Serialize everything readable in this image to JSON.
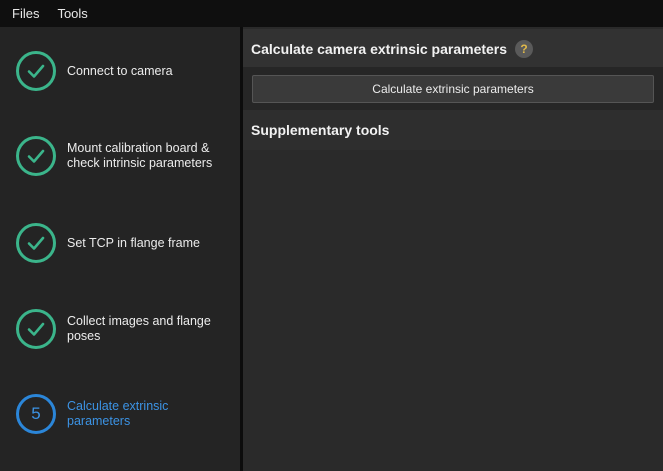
{
  "menubar": {
    "items": [
      "Files",
      "Tools"
    ]
  },
  "steps": [
    {
      "label": "Connect to camera",
      "status": "done"
    },
    {
      "label": "Mount calibration board & check intrinsic parameters",
      "status": "done"
    },
    {
      "label": "Set TCP in flange frame",
      "status": "done"
    },
    {
      "label": "Collect images and flange poses",
      "status": "done"
    },
    {
      "label": "Calculate extrinsic parameters",
      "status": "current",
      "number": "5"
    }
  ],
  "main": {
    "section_title": "Calculate camera extrinsic parameters",
    "help_symbol": "?",
    "calculate_button": "Calculate extrinsic parameters",
    "supplementary_title": "Supplementary tools"
  },
  "colors": {
    "done": "#3bb58b",
    "current": "#2b86d9"
  }
}
